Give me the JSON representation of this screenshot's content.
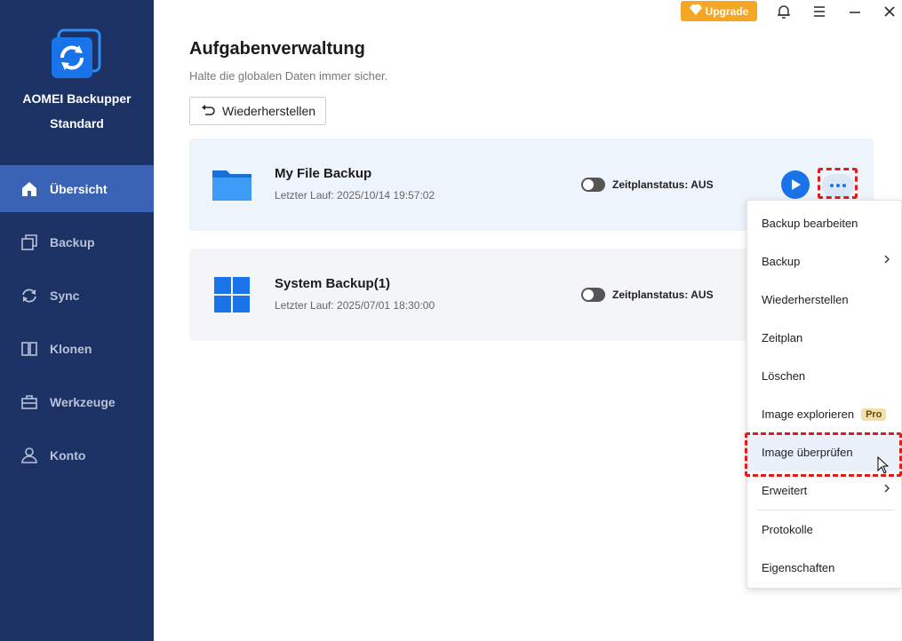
{
  "app": {
    "name": "AOMEI Backupper",
    "edition": "Standard"
  },
  "topbar": {
    "upgrade_label": "Upgrade"
  },
  "sidebar": {
    "items": [
      {
        "label": "Übersicht",
        "icon": "home-icon",
        "active": true
      },
      {
        "label": "Backup",
        "icon": "backup-icon",
        "active": false
      },
      {
        "label": "Sync",
        "icon": "sync-icon",
        "active": false
      },
      {
        "label": "Klonen",
        "icon": "clone-icon",
        "active": false
      },
      {
        "label": "Werkzeuge",
        "icon": "toolbox-icon",
        "active": false
      },
      {
        "label": "Konto",
        "icon": "user-icon",
        "active": false
      }
    ]
  },
  "main": {
    "title": "Aufgabenverwaltung",
    "subtitle": "Halte die globalen Daten immer sicher.",
    "restore_label": "Wiederherstellen",
    "tasks": [
      {
        "name": "My File Backup",
        "last_run": "Letzter Lauf: 2025/10/14 19:57:02",
        "schedule": "Zeitplanstatus: AUS",
        "icon": "folder-icon"
      },
      {
        "name": "System Backup(1)",
        "last_run": "Letzter Lauf: 2025/07/01 18:30:00",
        "schedule": "Zeitplanstatus: AUS",
        "icon": "windows-icon"
      }
    ]
  },
  "context_menu": {
    "items": [
      {
        "label": "Backup bearbeiten"
      },
      {
        "label": "Backup",
        "submenu": true
      },
      {
        "label": "Wiederherstellen"
      },
      {
        "label": "Zeitplan"
      },
      {
        "label": "Löschen"
      },
      {
        "label": "Image explorieren",
        "badge": "Pro"
      },
      {
        "label": "Image überprüfen",
        "hovered": true
      },
      {
        "label": "Erweitert",
        "submenu": true
      },
      {
        "label": "Protokolle"
      },
      {
        "label": "Eigenschaften"
      }
    ]
  },
  "colors": {
    "sidebar_bg": "#1d3264",
    "accent": "#1a73e8",
    "upgrade": "#f5a623",
    "highlight": "#e21b1b"
  }
}
